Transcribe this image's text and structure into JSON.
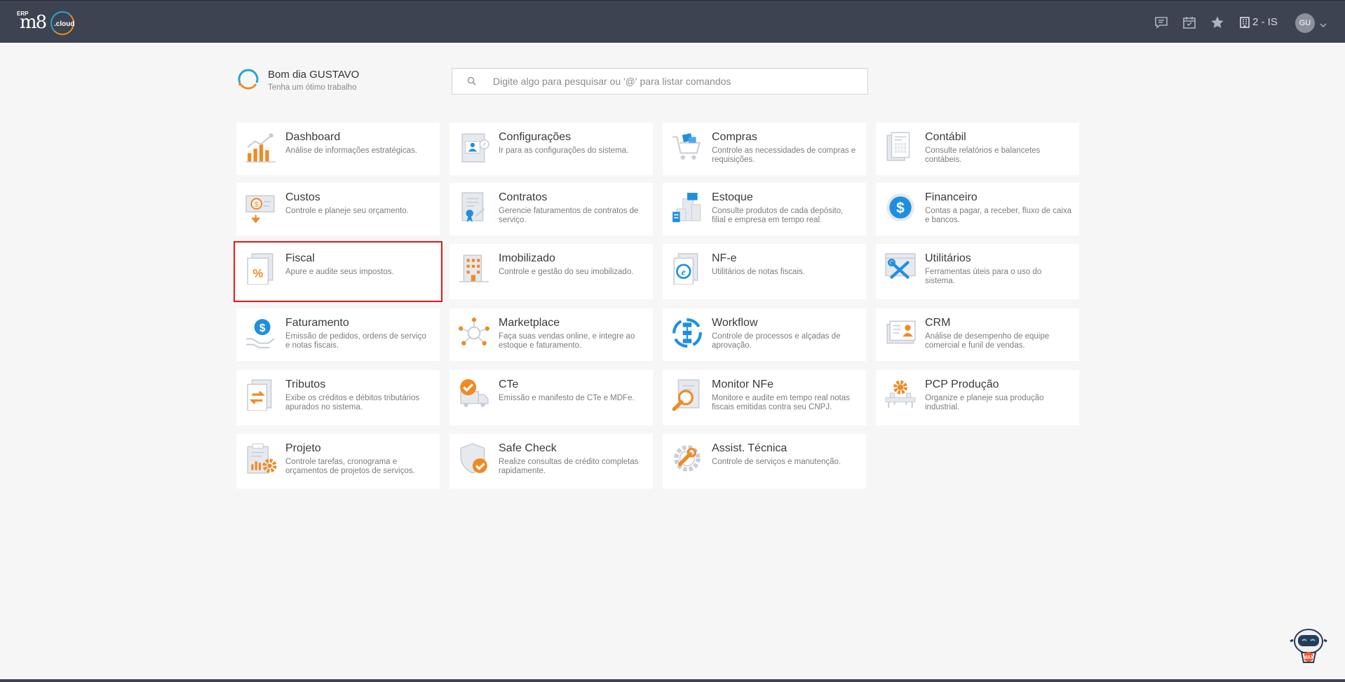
{
  "header": {
    "logo_erp": "ERP",
    "logo_m8": "m8",
    "logo_cloud": ".cloud",
    "company": "2 - IS",
    "avatar": "GU",
    "icons": [
      "chat-icon",
      "calendar-icon",
      "star-icon",
      "building-icon",
      "chevron-down-icon"
    ]
  },
  "greeting": {
    "hello": "Bom dia GUSTAVO",
    "sub": "Tenha um ótimo trabalho"
  },
  "search": {
    "placeholder": "Digite algo para pesquisar ou '@' para listar comandos"
  },
  "modules": [
    {
      "title": "Dashboard",
      "desc": "Análise de informações estratégicas.",
      "icon": "dashboard-chart-icon"
    },
    {
      "title": "Configurações",
      "desc": "Ir para as configurações do sistema.",
      "icon": "settings-profile-icon"
    },
    {
      "title": "Compras",
      "desc": "Controle as necessidades de compras e requisições.",
      "icon": "shopping-cart-icon"
    },
    {
      "title": "Contábil",
      "desc": "Consulte relatórios e balancetes contábeis.",
      "icon": "ledger-icon"
    },
    {
      "title": "Custos",
      "desc": "Controle e planeje seu orçamento.",
      "icon": "cost-money-icon"
    },
    {
      "title": "Contratos",
      "desc": "Gerencie faturamentos de contratos de serviço.",
      "icon": "contract-icon"
    },
    {
      "title": "Estoque",
      "desc": "Consulte produtos de cada depósito, filial e empresa em tempo real.",
      "icon": "warehouse-icon"
    },
    {
      "title": "Financeiro",
      "desc": "Contas a pagar, a receber, fluxo de caixa e bancos.",
      "icon": "dollar-coin-icon"
    },
    {
      "title": "Fiscal",
      "desc": "Apure e audite seus impostos.",
      "icon": "percent-document-icon"
    },
    {
      "title": "Imobilizado",
      "desc": "Controle e gestão do seu imobilizado.",
      "icon": "building-asset-icon"
    },
    {
      "title": "NF-e",
      "desc": "Utilitários de notas fiscais.",
      "icon": "nfe-document-icon"
    },
    {
      "title": "Utilitários",
      "desc": "Ferramentas úteis para o uso do sistema.",
      "icon": "tools-icon"
    },
    {
      "title": "Faturamento",
      "desc": "Emissão de pedidos, ordens de serviço e notas fiscais.",
      "icon": "billing-hand-icon"
    },
    {
      "title": "Marketplace",
      "desc": "Faça suas vendas online, e integre ao estoque e faturamento.",
      "icon": "marketplace-network-icon"
    },
    {
      "title": "Workflow",
      "desc": "Controle de processos e alçadas de aprovação.",
      "icon": "workflow-icon"
    },
    {
      "title": "CRM",
      "desc": "Análise de desempenho de equipe comercial e funil de vendas.",
      "icon": "crm-card-icon"
    },
    {
      "title": "Tributos",
      "desc": "Exibe os créditos e débitos tributários apurados no sistema.",
      "icon": "tax-exchange-icon"
    },
    {
      "title": "CTe",
      "desc": "Emissão e manifesto de CTe e MDFe.",
      "icon": "truck-check-icon"
    },
    {
      "title": "Monitor NFe",
      "desc": "Monitore e audite em tempo real notas fiscais emitidas contra seu CNPJ.",
      "icon": "magnifier-document-icon"
    },
    {
      "title": "PCP Produção",
      "desc": "Organize e planeje sua produção industrial.",
      "icon": "production-gear-icon"
    },
    {
      "title": "Projeto",
      "desc": "Controle tarefas, cronograma e orçamentos de projetos de serviços.",
      "icon": "project-clipboard-icon"
    },
    {
      "title": "Safe Check",
      "desc": "Realize consultas de crédito completas rapidamente.",
      "icon": "shield-check-icon"
    },
    {
      "title": "Assist. Técnica",
      "desc": "Controle de serviços e manutenção.",
      "icon": "wrench-gear-icon"
    }
  ],
  "selected_module": "Fiscal",
  "assistant": {
    "label": "MAX",
    "icon": "robot-assistant-icon"
  },
  "colors": {
    "topbar": "#3d4350",
    "accent_orange": "#f08a24",
    "accent_blue": "#1e8fe0",
    "selection": "#e21b1b"
  }
}
